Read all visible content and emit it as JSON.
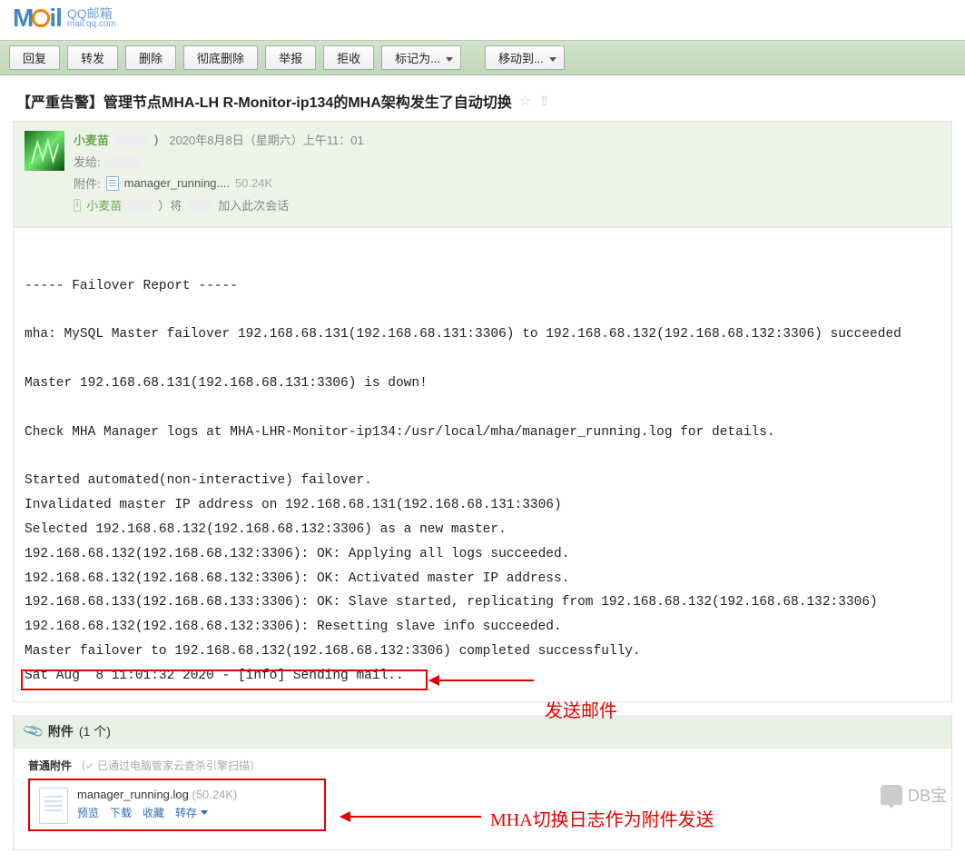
{
  "logo": {
    "sub_cn": "QQ邮箱",
    "sub_url": "mail.qq.com"
  },
  "toolbar": {
    "reply": "回复",
    "forward": "转发",
    "delete": "删除",
    "delete_perm": "彻底删除",
    "report": "举报",
    "reject": "拒收",
    "mark_as": "标记为...",
    "move_to": "移动到..."
  },
  "subject": "【严重告警】管理节点MHA-LH R-Monitor-ip134的MHA架构发生了自动切换",
  "header": {
    "sender_name": "小麦苗",
    "sender_id_suffix": ")",
    "date": "2020年8月8日（星期六）上午11：01",
    "to_label": "发给:",
    "attach_label": "附件:",
    "attach_name_trunc": "manager_running....",
    "attach_size": "50.24K",
    "thread_add_prefix": "小麦苗",
    "thread_add_mid": "）将",
    "thread_add_suffix": "加入此次会话"
  },
  "body_lines": [
    " ",
    "----- Failover Report -----",
    " ",
    "mha: MySQL Master failover 192.168.68.131(192.168.68.131:3306) to 192.168.68.132(192.168.68.132:3306) succeeded",
    " ",
    "Master 192.168.68.131(192.168.68.131:3306) is down!",
    " ",
    "Check MHA Manager logs at MHA-LHR-Monitor-ip134:/usr/local/mha/manager_running.log for details.",
    " ",
    "Started automated(non-interactive) failover.",
    "Invalidated master IP address on 192.168.68.131(192.168.68.131:3306)",
    "Selected 192.168.68.132(192.168.68.132:3306) as a new master.",
    "192.168.68.132(192.168.68.132:3306): OK: Applying all logs succeeded.",
    "192.168.68.132(192.168.68.132:3306): OK: Activated master IP address.",
    "192.168.68.133(192.168.68.133:3306): OK: Slave started, replicating from 192.168.68.132(192.168.68.132:3306)",
    "192.168.68.132(192.168.68.132:3306): Resetting slave info succeeded.",
    "Master failover to 192.168.68.132(192.168.68.132:3306) completed successfully.",
    "Sat Aug  8 11:01:32 2020 - [info] Sending mail.."
  ],
  "annotation1": "发送邮件",
  "attachments": {
    "title_label": "附件",
    "count_text": "(1 个)",
    "normal_label": "普通附件",
    "scan_text": "已通过电脑管家云查杀引擎扫描",
    "file_name": "manager_running.log",
    "file_size": "(50.24K)",
    "actions": {
      "preview": "预览",
      "download": "下载",
      "favorite": "收藏",
      "transfer": "转存"
    }
  },
  "annotation2": "MHA切换日志作为附件发送",
  "watermark": "DB宝"
}
